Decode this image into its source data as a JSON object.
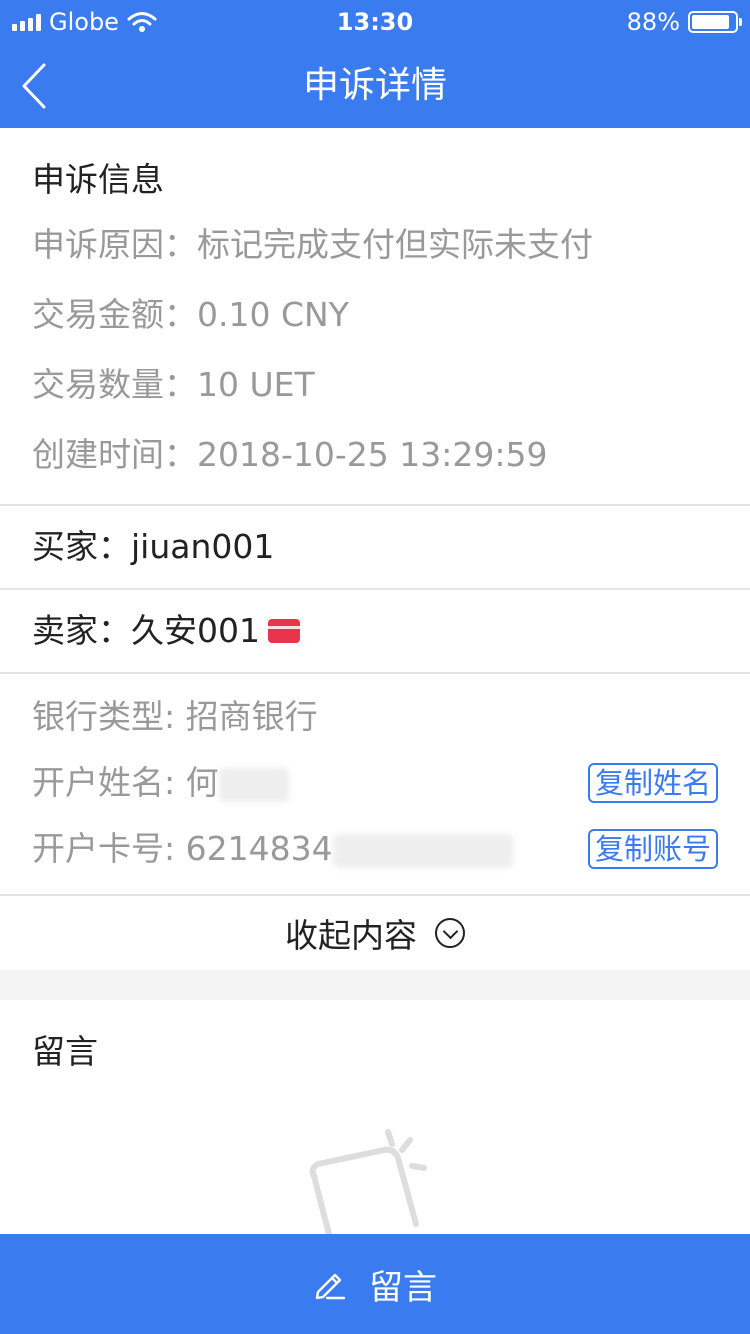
{
  "status_bar": {
    "carrier": "Globe",
    "time": "13:30",
    "battery_percent": "88%",
    "battery_level": 0.88,
    "icons": [
      "signal-icon",
      "wifi-icon",
      "battery-icon"
    ]
  },
  "nav": {
    "title": "申诉详情",
    "back_icon": "chevron-left-icon"
  },
  "appeal": {
    "section_title": "申诉信息",
    "rows": [
      {
        "label": "申诉原因：",
        "value": "标记完成支付但实际未支付"
      },
      {
        "label": "交易金额：",
        "value": "0.10 CNY"
      },
      {
        "label": "交易数量：",
        "value": "10 UET"
      },
      {
        "label": "创建时间：",
        "value": "2018-10-25 13:29:59"
      }
    ]
  },
  "buyer": {
    "label": "买家：",
    "value": "jiuan001"
  },
  "seller": {
    "label": "卖家：",
    "value": "久安001",
    "icon": "bank-card-icon"
  },
  "bank": {
    "type_label": "银行类型:",
    "type_value": "招商银行",
    "name_label": "开户姓名:",
    "name_value": "何",
    "copy_name_label": "复制姓名",
    "card_label": "开户卡号:",
    "card_value": "6214834",
    "copy_account_label": "复制账号"
  },
  "collapse": {
    "label": "收起内容",
    "icon": "chevron-down-circle-icon"
  },
  "messages": {
    "section_title": "留言",
    "empty_icon": "empty-note-icon"
  },
  "bottom_action": {
    "label": "留言",
    "icon": "pencil-icon"
  },
  "colors": {
    "primary": "#3b7bf0",
    "card_icon": "#e8354b",
    "muted_text": "#999999",
    "divider": "#e4e4e4"
  }
}
